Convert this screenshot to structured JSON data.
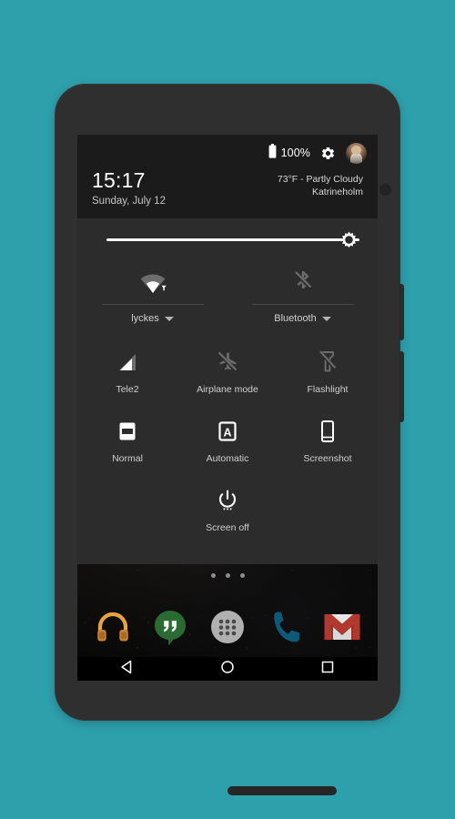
{
  "device": {
    "frame_color": "#2f2f2f",
    "background_color": "#2ea0ac",
    "earpiece": "earpiece-speaker",
    "front_camera": "front-camera",
    "bottom_speaker": "bottom-speaker",
    "buttons": [
      {
        "name": "power-button"
      },
      {
        "name": "volume-rocker"
      }
    ]
  },
  "statusbar": {
    "battery_icon": "battery-full-icon",
    "battery_percent": "100%",
    "settings_icon": "gear-icon",
    "avatar": "user-avatar"
  },
  "header": {
    "time": "15:17",
    "date": "Sunday, July 12",
    "weather_conditions": "73°F - Partly Cloudy",
    "weather_location": "Katrineholm"
  },
  "brightness": {
    "label": "brightness-slider",
    "value_percent": 95,
    "thumb_icon": "brightness-sun-icon",
    "track_color": "#ffffff"
  },
  "connectivity_tiles": [
    {
      "name": "wifi",
      "icon": "wifi-icon",
      "label": "lyckes",
      "enabled": true,
      "has_caret": true
    },
    {
      "name": "bluetooth",
      "icon": "bluetooth-off-icon",
      "label": "Bluetooth",
      "enabled": false,
      "has_caret": true
    }
  ],
  "quick_tiles": [
    {
      "name": "cellular",
      "icon": "signal-bars-icon",
      "label": "Tele2"
    },
    {
      "name": "airplane-mode",
      "icon": "airplane-off-icon",
      "label": "Airplane mode"
    },
    {
      "name": "flashlight",
      "icon": "flashlight-off-icon",
      "label": "Flashlight"
    },
    {
      "name": "rotation",
      "icon": "rotation-normal-icon",
      "label": "Normal"
    },
    {
      "name": "display-mode",
      "icon": "auto-letter-icon",
      "label": "Automatic"
    },
    {
      "name": "screenshot",
      "icon": "screenshot-phone-icon",
      "label": "Screenshot"
    },
    {
      "name": "screen-off",
      "icon": "power-icon",
      "label": "Screen off"
    }
  ],
  "home": {
    "page_dots": 3,
    "active_dot_index": 1
  },
  "dock": [
    {
      "name": "play-music",
      "icon": "headphones-icon",
      "color": "#e8a33d"
    },
    {
      "name": "hangouts",
      "icon": "quote-bubble-icon",
      "color": "#2a6b33"
    },
    {
      "name": "app-drawer",
      "icon": "grid-dots-icon",
      "color": "#b0b0b0"
    },
    {
      "name": "phone",
      "icon": "handset-icon",
      "color": "#0c5a78"
    },
    {
      "name": "gmail",
      "icon": "envelope-icon",
      "color": "#b3392f"
    }
  ],
  "navbar": [
    {
      "name": "back",
      "icon": "triangle-back-icon"
    },
    {
      "name": "home",
      "icon": "circle-home-icon"
    },
    {
      "name": "recents",
      "icon": "square-recents-icon"
    }
  ]
}
